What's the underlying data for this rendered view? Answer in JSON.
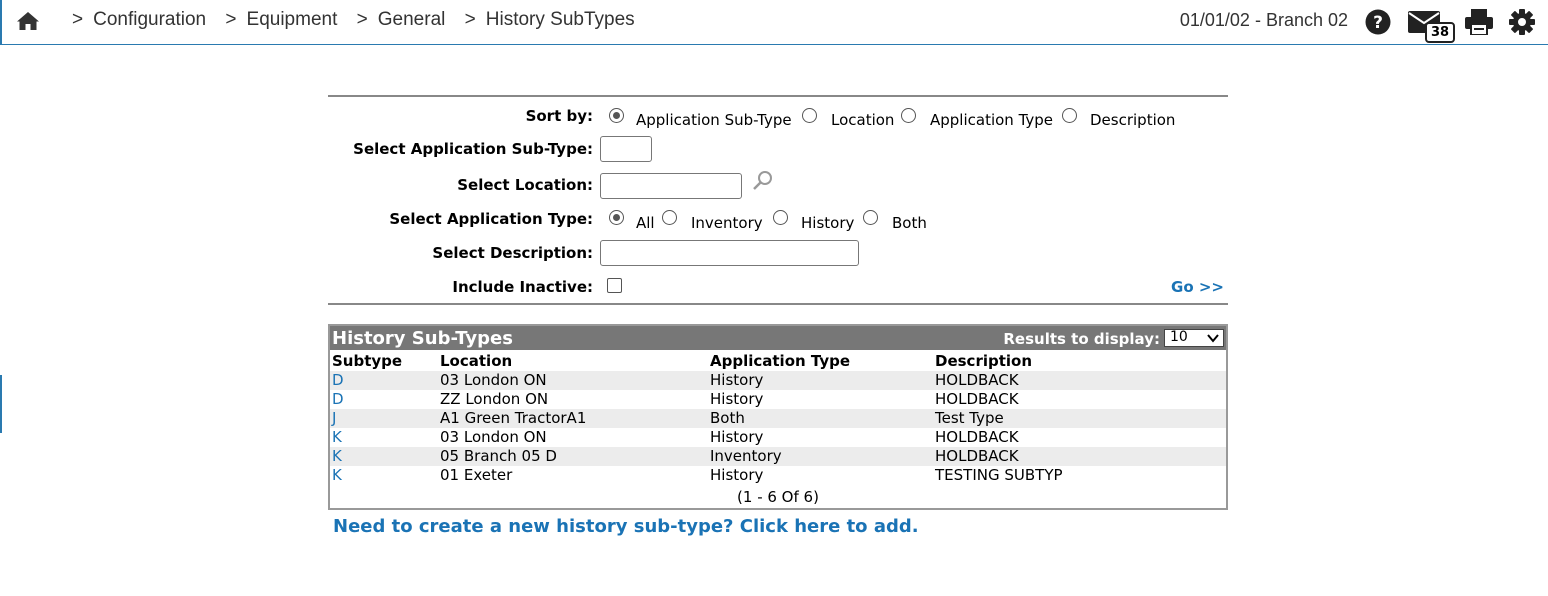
{
  "breadcrumb": {
    "items": [
      "Configuration",
      "Equipment",
      "General",
      "History SubTypes"
    ],
    "separator": ">"
  },
  "header": {
    "date_branch": "01/01/02 - Branch 02",
    "mail_count": "38"
  },
  "filters": {
    "sort_by_label": "Sort by:",
    "sort_options": [
      "Application Sub-Type",
      "Location",
      "Application Type",
      "Description"
    ],
    "sort_selected": "Application Sub-Type",
    "subtype_label": "Select Application Sub-Type:",
    "subtype_value": "",
    "location_label": "Select Location:",
    "location_value": "",
    "app_type_label": "Select Application Type:",
    "app_type_options": [
      "All",
      "Inventory",
      "History",
      "Both"
    ],
    "app_type_selected": "All",
    "description_label": "Select Description:",
    "description_value": "",
    "inactive_label": "Include Inactive:",
    "go_label": "Go >>"
  },
  "results": {
    "title": "History Sub-Types",
    "display_label": "Results to display:",
    "display_value": "10",
    "columns": [
      "Subtype",
      "Location",
      "Application Type",
      "Description"
    ],
    "rows": [
      [
        "D",
        "03 London ON",
        "History",
        "HOLDBACK"
      ],
      [
        "D",
        "ZZ London ON",
        "History",
        "HOLDBACK"
      ],
      [
        "J",
        "A1 Green TractorA1",
        "Both",
        "Test Type"
      ],
      [
        "K",
        "03 London ON",
        "History",
        "HOLDBACK"
      ],
      [
        "K",
        "05 Branch 05 D",
        "Inventory",
        "HOLDBACK"
      ],
      [
        "K",
        "01 Exeter",
        "History",
        "TESTING SUBTYP"
      ]
    ],
    "pager": "(1 - 6 Of 6)"
  },
  "add_link": "Need to create a new history sub-type? Click here to add.",
  "colors": {
    "link": "#1a73b5",
    "header_bg": "#777777",
    "accent": "#2a7ab0"
  }
}
